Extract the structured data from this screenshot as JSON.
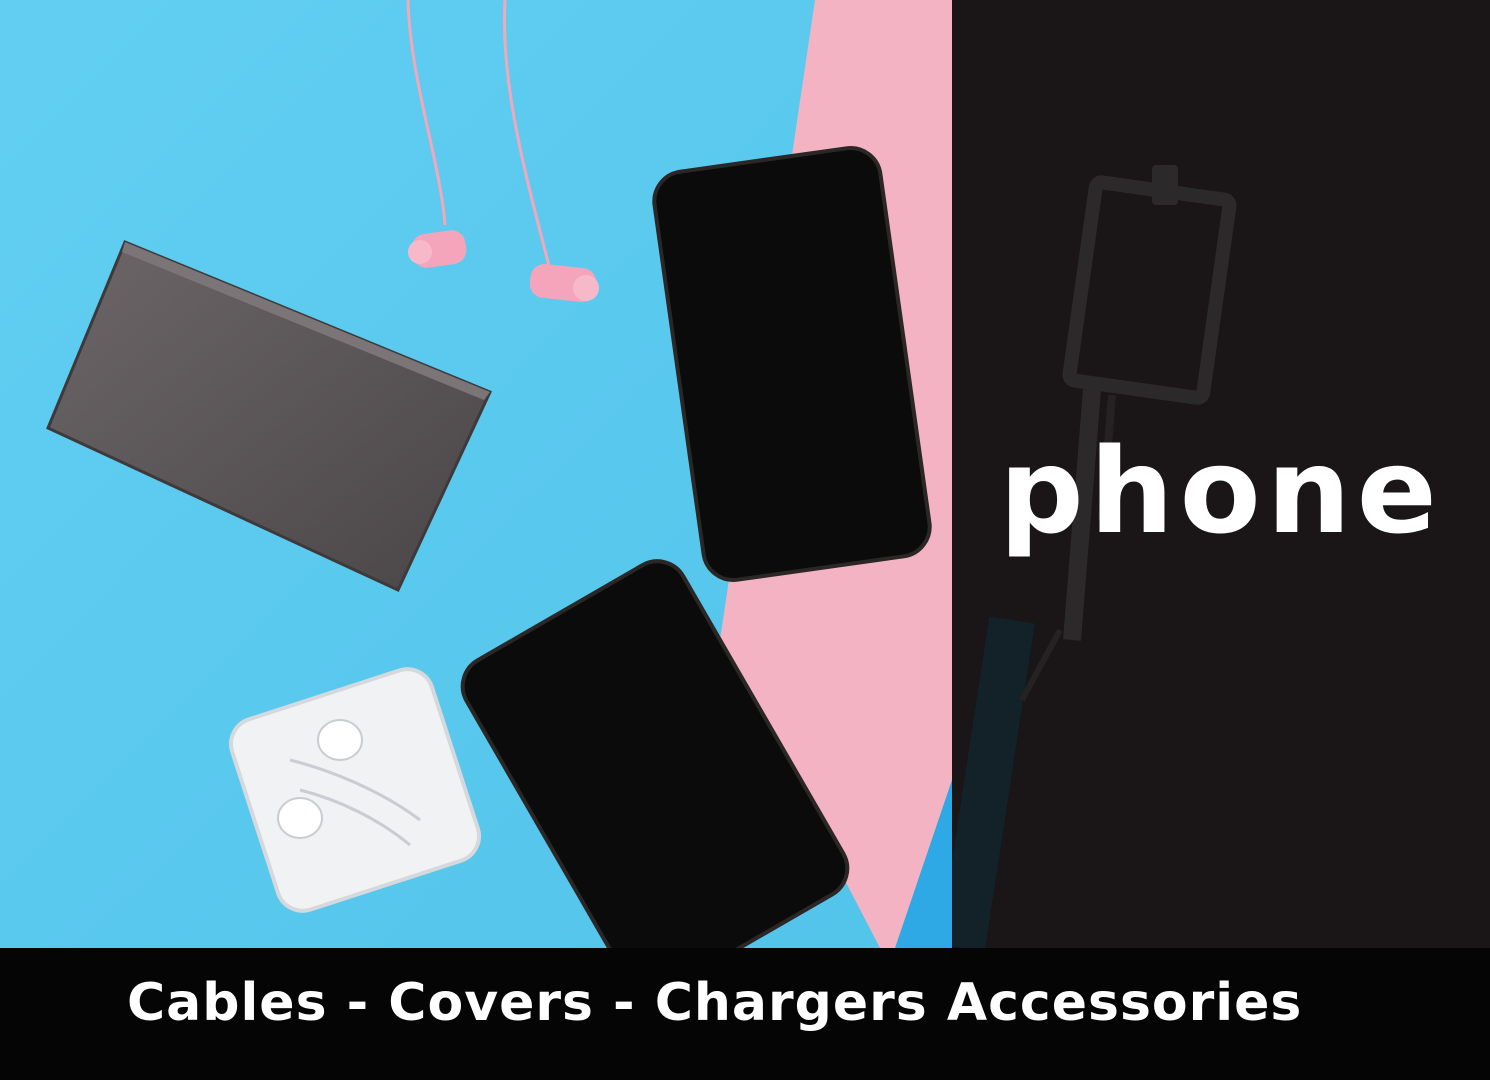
{
  "banner": {
    "brand_word": "phone",
    "caption": "Cables - Covers - Chargers Accessories"
  },
  "colors": {
    "sky_blue_background": "#5ccbef",
    "pink_background": "#f4b3c3",
    "dark_panel": "#1a1516",
    "caption_bar": "#050505",
    "text": "#ffffff"
  },
  "photo_objects": {
    "items": [
      "power-bank",
      "pink-earbuds",
      "smartphone",
      "smartphone",
      "white-earphones-case"
    ]
  },
  "panel_objects": {
    "items": [
      "selfie-stick"
    ]
  }
}
